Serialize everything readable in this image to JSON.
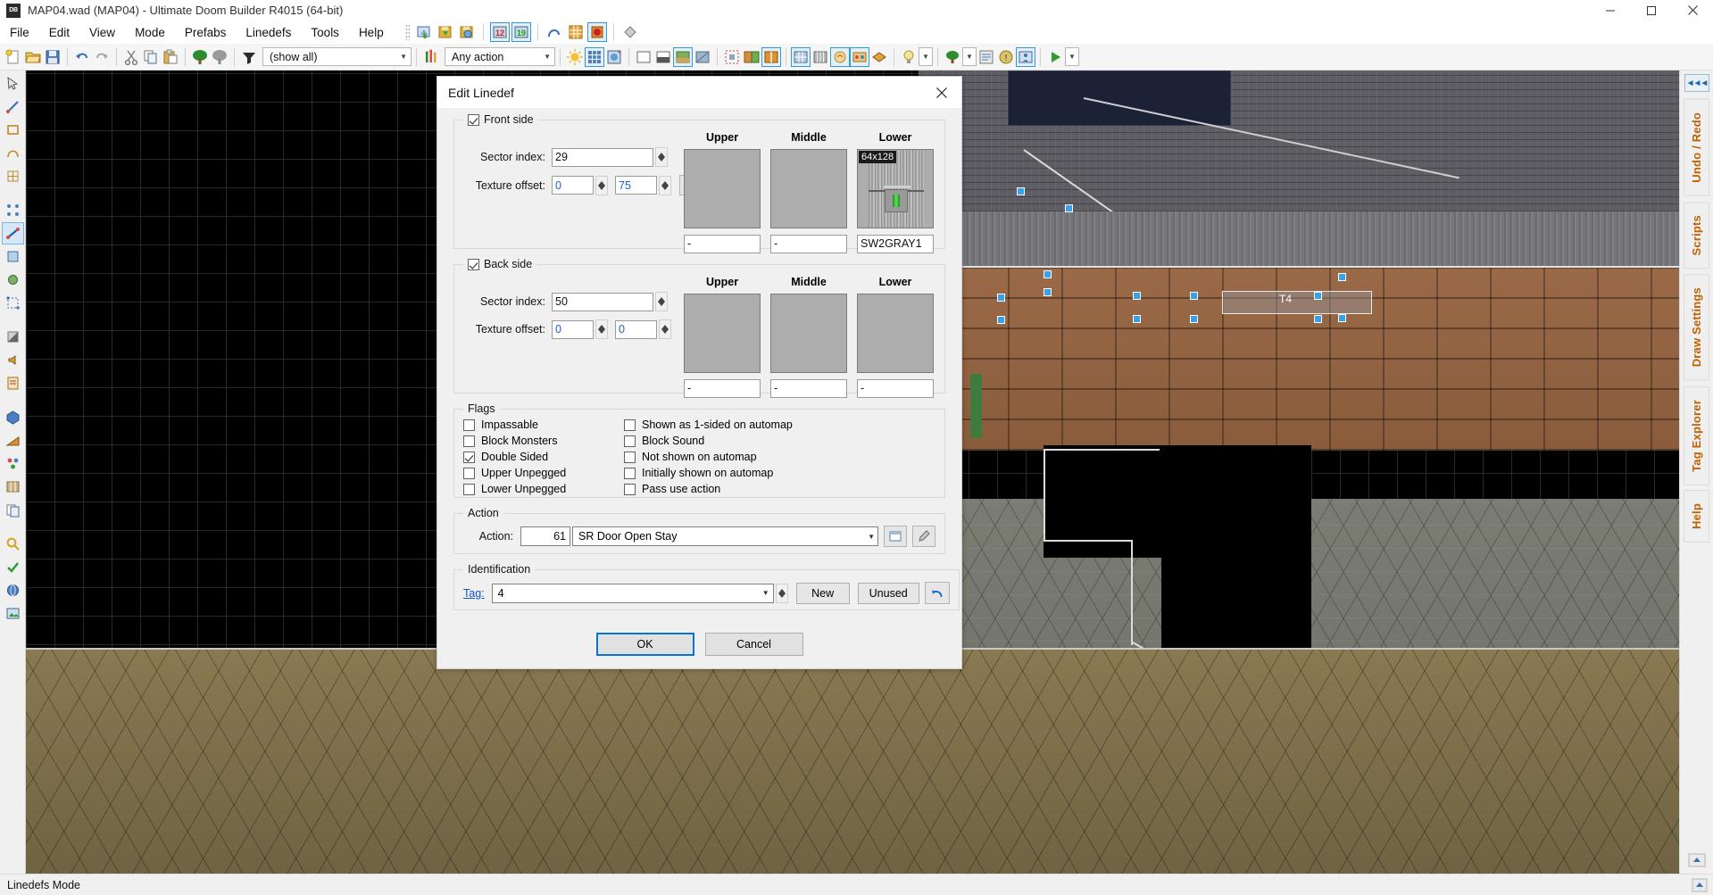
{
  "window": {
    "title": "MAP04.wad (MAP04) - Ultimate Doom Builder R4015 (64-bit)",
    "app_icon": "DB",
    "minimize": "minimize-icon",
    "maximize": "maximize-icon",
    "close": "close-icon"
  },
  "menu": {
    "items": [
      "File",
      "Edit",
      "View",
      "Mode",
      "Prefabs",
      "Linedefs",
      "Tools",
      "Help"
    ]
  },
  "toolbar": {
    "filter_label": "(show all)",
    "action_label": "Any action"
  },
  "dialog": {
    "title": "Edit Linedef",
    "front": {
      "group_label": "Front side",
      "checked": true,
      "sector_index_label": "Sector index:",
      "sector_index": "29",
      "texture_offset_label": "Texture offset:",
      "offset_x": "0",
      "offset_y": "75",
      "columns": [
        {
          "header": "Upper",
          "size": "",
          "name": "-"
        },
        {
          "header": "Middle",
          "size": "",
          "name": "-"
        },
        {
          "header": "Lower",
          "size": "64x128",
          "name": "SW2GRAY1"
        }
      ]
    },
    "back": {
      "group_label": "Back side",
      "checked": true,
      "sector_index_label": "Sector index:",
      "sector_index": "50",
      "texture_offset_label": "Texture offset:",
      "offset_x": "0",
      "offset_y": "0",
      "columns": [
        {
          "header": "Upper",
          "size": "",
          "name": "-"
        },
        {
          "header": "Middle",
          "size": "",
          "name": "-"
        },
        {
          "header": "Lower",
          "size": "",
          "name": "-"
        }
      ]
    },
    "flags": {
      "group_label": "Flags",
      "left": [
        {
          "label": "Impassable",
          "checked": false
        },
        {
          "label": "Block Monsters",
          "checked": false
        },
        {
          "label": "Double Sided",
          "checked": true
        },
        {
          "label": "Upper Unpegged",
          "checked": false
        },
        {
          "label": "Lower Unpegged",
          "checked": false
        }
      ],
      "right": [
        {
          "label": "Shown as 1-sided on automap",
          "checked": false
        },
        {
          "label": "Block Sound",
          "checked": false
        },
        {
          "label": "Not shown on automap",
          "checked": false
        },
        {
          "label": "Initially shown on automap",
          "checked": false
        },
        {
          "label": "Pass use action",
          "checked": false
        }
      ]
    },
    "action": {
      "group_label": "Action",
      "field_label": "Action:",
      "number": "61",
      "name": "SR Door Open Stay",
      "browse_icon": "browse-action-icon",
      "pick_icon": "eyedropper-icon"
    },
    "identification": {
      "group_label": "Identification",
      "tag_label": "Tag:",
      "tag_value": "4",
      "new_label": "New",
      "unused_label": "Unused",
      "reset_icon": "reset-arrow-icon"
    },
    "footer": {
      "ok_label": "OK",
      "cancel_label": "Cancel"
    }
  },
  "rightdock": {
    "collapse_icon": "collapse-panel-icon",
    "tabs": [
      "Undo / Redo",
      "Scripts",
      "Draw Settings",
      "Tag Explorer",
      "Help"
    ]
  },
  "statusbar": {
    "mode_text": "Linedefs Mode"
  },
  "map": {
    "thing_label": "T4"
  },
  "colors": {
    "accent": "#0a74d4",
    "tag_link": "#1155cc",
    "dock_tab_text": "#c06000",
    "value_blue": "#1b5fd0",
    "canvas_bg": "#000000"
  }
}
